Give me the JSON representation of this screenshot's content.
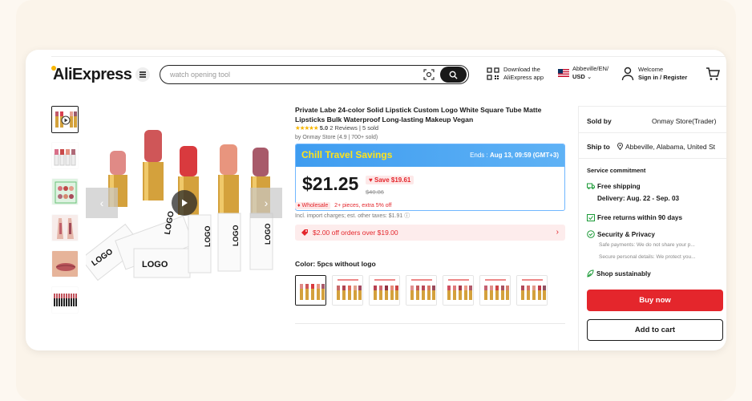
{
  "header": {
    "logo": "AliExpress",
    "search_placeholder": "watch opening tool",
    "download_line1": "Download the",
    "download_line2": "AliExpress app",
    "locale_line1": "Abbeville/EN/",
    "locale_line2": "USD",
    "welcome_line1": "Welcome",
    "welcome_line2": "Sign in / Register"
  },
  "product": {
    "title": "Private Labe 24-color Solid Lipstick Custom Logo White Square Tube Matte Lipsticks Bulk Waterproof Long-lasting Makeup Vegan",
    "rating": "5.0",
    "reviews": "2 Reviews",
    "sold": "5 sold",
    "store_line": "by Onmay Store (4.9 | 700+ sold)",
    "deal_name": "Chill Travel Savings",
    "deal_ends_label": "Ends : ",
    "deal_ends_value": "Aug 13, 09:59 (GMT+3)",
    "price": "$21.25",
    "save": "Save $19.61",
    "original_price": "$40.86",
    "wholesale_tag": "Wholesale",
    "wholesale_text": "2+ pieces, extra 5% off",
    "tax_text": "Incl. import charges; est. other taxes: $1.91",
    "coupon_text": "$2.00 off orders over $19.00",
    "color_label": "Color: 5pcs without logo",
    "image_logo_text": "LOGO"
  },
  "side": {
    "sold_by_label": "Sold by",
    "sold_by_value": "Onmay Store(Trader)",
    "ship_to_label": "Ship to",
    "ship_to_value": "Abbeville, Alabama, United St",
    "service_label": "Service commitment",
    "free_shipping": "Free shipping",
    "delivery": "Delivery: Aug. 22 - Sep. 03",
    "free_returns": "Free returns within 90 days",
    "security": "Security & Privacy",
    "safe_payments": "Safe payments: We do not share your p...",
    "secure_details": "Secure personal details: We protect you...",
    "shop_sustainably": "Shop sustainably",
    "buy_now": "Buy now",
    "add_to_cart": "Add to cart"
  },
  "colors": {
    "accent_red": "#e4262c",
    "deal_blue": "#3e9cf0",
    "deal_yellow": "#ffe31a",
    "green": "#1a9a36"
  }
}
